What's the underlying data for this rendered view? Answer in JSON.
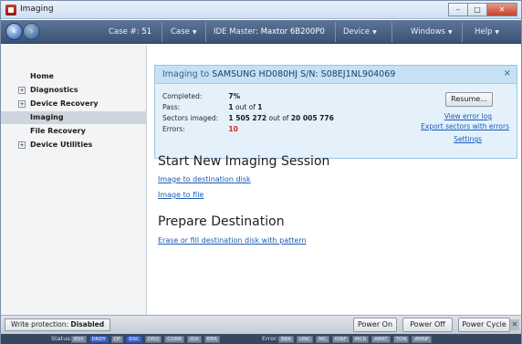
{
  "window": {
    "title": "Imaging",
    "controls": [
      "–",
      "□",
      "✕"
    ]
  },
  "toolbar": {
    "case_label": "Case #:",
    "case_value": "51",
    "case_menu": "Case",
    "ide_label": "IDE Master:",
    "ide_value": "Maxtor 6B200P0",
    "device_menu": "Device",
    "windows_menu": "Windows",
    "help_menu": "Help"
  },
  "sidebar": {
    "items": [
      {
        "label": "Home",
        "expandable": false,
        "active": false
      },
      {
        "label": "Diagnostics",
        "expandable": true,
        "active": false
      },
      {
        "label": "Device Recovery",
        "expandable": true,
        "active": false
      },
      {
        "label": "Imaging",
        "expandable": false,
        "active": true
      },
      {
        "label": "File Recovery",
        "expandable": false,
        "active": false
      },
      {
        "label": "Device Utilities",
        "expandable": true,
        "active": false
      }
    ]
  },
  "status_panel": {
    "title_prefix": "Imaging to",
    "title_device": "SAMSUNG HD080HJ S/N: S08EJ1NL904069",
    "close": "×",
    "completed_label": "Completed:",
    "completed_value": "7%",
    "pass_label": "Pass:",
    "pass_current": "1",
    "pass_mid": "out of",
    "pass_total": "1",
    "sectors_label": "Sectors imaged:",
    "sectors_done": "1 505 272",
    "sectors_mid": "out of",
    "sectors_total": "20 005 776",
    "errors_label": "Errors:",
    "errors_value": "10",
    "resume_button": "Resume...",
    "link_error_log": "View error log",
    "link_export": "Export sectors with errors",
    "link_settings": "Settings"
  },
  "start_section": {
    "title": "Start New Imaging Session",
    "link_disk": "Image to destination disk",
    "link_file": "Image to file"
  },
  "prepare_section": {
    "title": "Prepare Destination",
    "link_erase": "Erase or fill destination disk with pattern"
  },
  "bottombar": {
    "write_protection_label": "Write protection:",
    "write_protection_value": "Disabled",
    "power_on": "Power On",
    "power_off": "Power Off",
    "power_cycle": "Power Cycle",
    "close": "✕"
  },
  "regstrip": {
    "status_label": "Status:",
    "status_regs": [
      {
        "name": "BSY",
        "on": false
      },
      {
        "name": "DRDY",
        "on": true
      },
      {
        "name": "DF",
        "on": false
      },
      {
        "name": "DSC",
        "on": true
      },
      {
        "name": "DRQ",
        "on": false
      },
      {
        "name": "CORR",
        "on": false
      },
      {
        "name": "IDX",
        "on": false
      },
      {
        "name": "ERR",
        "on": false
      }
    ],
    "error_label": "Error:",
    "error_regs": [
      {
        "name": "BBK",
        "on": false
      },
      {
        "name": "UNC",
        "on": false
      },
      {
        "name": "MC",
        "on": false
      },
      {
        "name": "IDNF",
        "on": false
      },
      {
        "name": "MCR",
        "on": false
      },
      {
        "name": "ABRT",
        "on": false
      },
      {
        "name": "TON",
        "on": false
      },
      {
        "name": "AMNF",
        "on": false
      }
    ]
  },
  "colors": {
    "link": "#1b5ab3",
    "error": "#e02020",
    "toolbar": "#3a5374",
    "panel": "#e4f1fb",
    "reg_on": "#3b63c9"
  }
}
